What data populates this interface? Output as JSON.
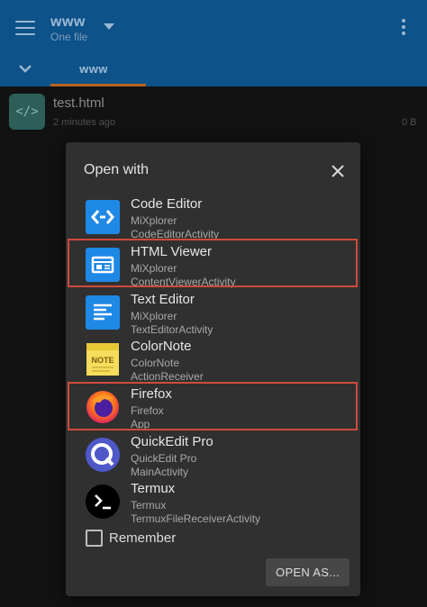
{
  "appbar": {
    "title": "www",
    "subtitle": "One file",
    "tab_label": "www"
  },
  "file": {
    "icon_text": "</>",
    "name": "test.html",
    "time": "2 minutes ago",
    "size": "0 B"
  },
  "dialog": {
    "title": "Open with",
    "apps": [
      {
        "name": "Code Editor",
        "package": "MiXplorer",
        "activity": "CodeEditorActivity",
        "icon": "code-editor-icon"
      },
      {
        "name": "HTML Viewer",
        "package": "MiXplorer",
        "activity": "ContentViewerActivity",
        "icon": "html-viewer-icon"
      },
      {
        "name": "Text Editor",
        "package": "MiXplorer",
        "activity": "TextEditorActivity",
        "icon": "text-editor-icon"
      },
      {
        "name": "ColorNote",
        "package": "ColorNote",
        "activity": "ActionReceiver",
        "icon": "colornote-icon",
        "icon_text": "NOTE"
      },
      {
        "name": "Firefox",
        "package": "Firefox",
        "activity": "App",
        "icon": "firefox-icon"
      },
      {
        "name": "QuickEdit Pro",
        "package": "QuickEdit Pro",
        "activity": "MainActivity",
        "icon": "quickedit-icon"
      },
      {
        "name": "Termux",
        "package": "Termux",
        "activity": "TermuxFileReceiverActivity",
        "icon": "termux-icon"
      }
    ],
    "remember_label": "Remember",
    "open_as_label": "OPEN AS..."
  },
  "colors": {
    "appbar": "#0d5289",
    "tab_indicator": "#b8641e",
    "dialog_bg": "#303030",
    "highlight": "#d04a3c"
  }
}
